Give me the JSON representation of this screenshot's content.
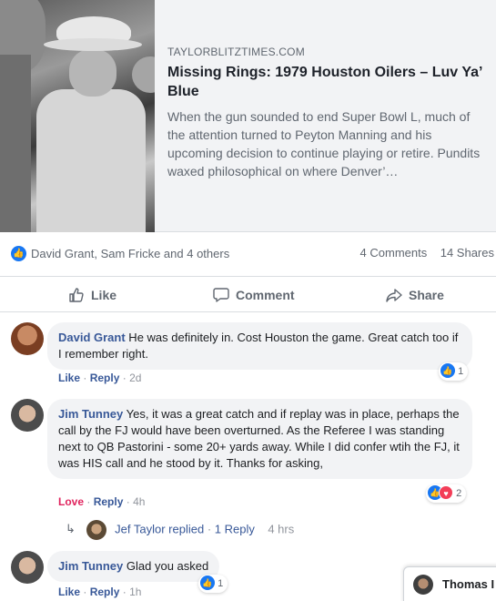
{
  "link_preview": {
    "domain": "TAYLORBLITZTIMES.COM",
    "title": "Missing Rings: 1979 Houston Oilers – Luv Ya’ Blue",
    "description": "When the gun sounded to end Super Bowl L, much of the attention turned to Peyton Manning and his upcoming decision to continue playing or retire. Pundits waxed philosophical on where Denver’…"
  },
  "reactions_summary": {
    "names": "David Grant, Sam Fricke and 4 others",
    "comments_count": "4 Comments",
    "shares_count": "14 Shares"
  },
  "actions": {
    "like": "Like",
    "comment": "Comment",
    "share": "Share"
  },
  "comments": [
    {
      "author": "David Grant",
      "text": " He was definitely in. Cost Houston the game. Great catch too if I remember right.",
      "reaction_label": "Like",
      "reply_label": "Reply",
      "time": "2d",
      "reaction_count": "1"
    },
    {
      "author": "Jim Tunney",
      "text": " Yes, it was a great catch and if replay was in place, perhaps the call by the FJ would have been overturned. As the Referee I was standing next to QB Pastorini - some 20+ yards away. While I did confer wtih the FJ, it was HIS call and he stood by it. Thanks for asking,",
      "reaction_label": "Love",
      "reply_label": "Reply",
      "time": "4h",
      "reaction_count": "2"
    },
    {
      "author": "Jim Tunney",
      "text": " Glad you asked",
      "reaction_label": "Like",
      "reply_label": "Reply",
      "time": "1h",
      "reaction_count": "1"
    }
  ],
  "reply_thread": {
    "replier": "Jef Taylor replied",
    "count": "1 Reply",
    "time": "4 hrs"
  },
  "chat": {
    "name": "Thomas I"
  },
  "colors": {
    "link": "#385898",
    "like_blue": "#1877f2",
    "love_red": "#f33e58"
  }
}
